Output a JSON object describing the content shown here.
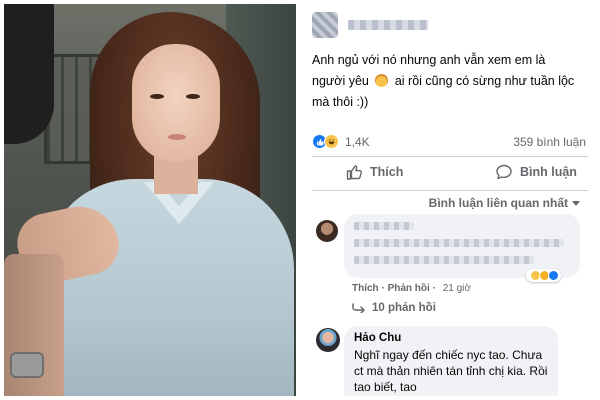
{
  "post": {
    "text_before_emoji": "Anh ngủ với nó nhưng anh vẫn xem em là người yêu",
    "text_after_emoji": "ai rồi cũng có sừng như tuần lộc mà thôi :))",
    "reaction_count": "1,4K",
    "comment_count": "359 bình luận",
    "actions": {
      "like_label": "Thích",
      "comment_label": "Bình luận"
    },
    "sort_label": "Bình luận liên quan nhất"
  },
  "comments": [
    {
      "meta_like": "Thích",
      "meta_reply": "Phản hồi",
      "time": "21 giờ",
      "replies_label": "10 phản hồi"
    },
    {
      "author": "Hảo Chu",
      "text": "Nghĩ ngay đến chiếc nyc tao. Chưa ct mà thản nhiên tán tỉnh chị kia. Rồi tao biết, tao"
    }
  ],
  "colors": {
    "brand_blue": "#1877f2",
    "muted_text": "#65676b",
    "bubble": "#f0f2f5"
  },
  "icons": [
    "like-reaction-icon",
    "haha-reaction-icon",
    "thumbs-up-icon",
    "comment-icon",
    "reply-arrow-icon",
    "emoji-face-icon"
  ]
}
